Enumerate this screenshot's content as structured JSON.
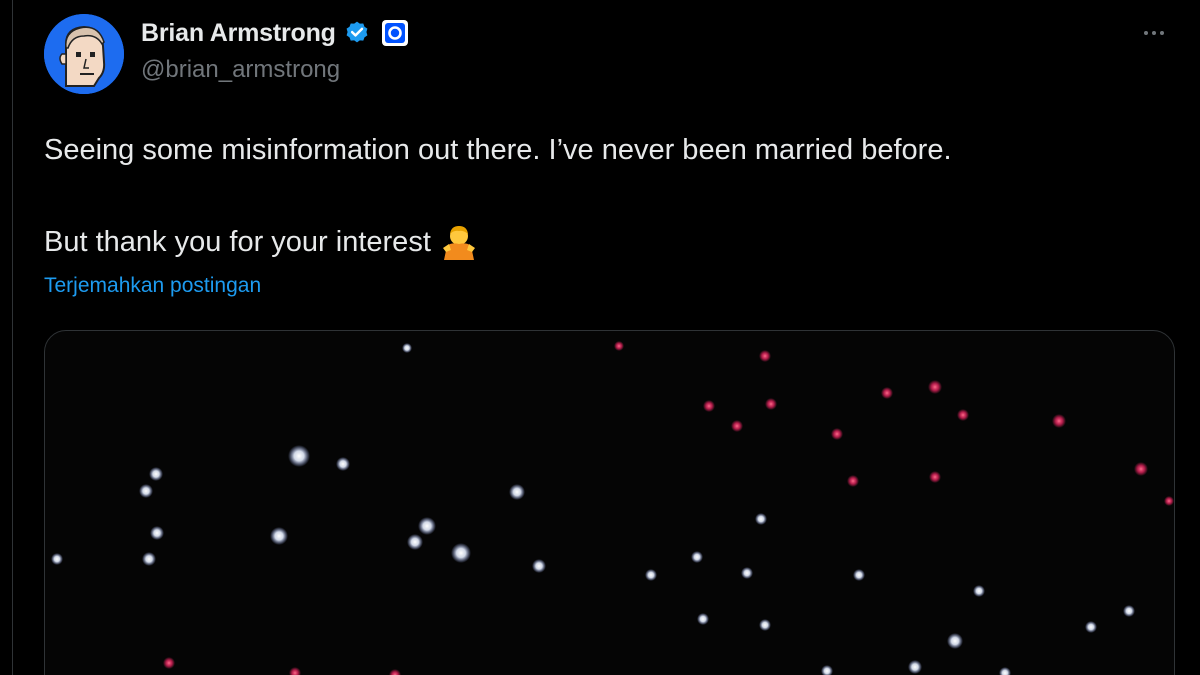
{
  "author": {
    "display_name": "Brian Armstrong",
    "handle": "@brian_armstrong",
    "verified": true,
    "affiliation_badge": "coinbase-logo",
    "avatar": "cartoon-avatar"
  },
  "tweet": {
    "line1": "Seeing some misinformation out there. I’ve never been married before.",
    "line2": "But thank you for your interest",
    "line2_emoji": "person-gesturing-ok-emoji",
    "translate_label": "Terjemahkan postingan"
  },
  "media": {
    "type": "video-still",
    "description_icon": "drone-light-show-image"
  },
  "colors": {
    "background": "#000000",
    "text": "#e7e9ea",
    "muted": "#71767b",
    "link": "#1d9bf0",
    "verified": "#1d9bf0",
    "coinbase": "#0052ff",
    "light_white": "#f2f6ff",
    "light_red": "#e0245e"
  }
}
